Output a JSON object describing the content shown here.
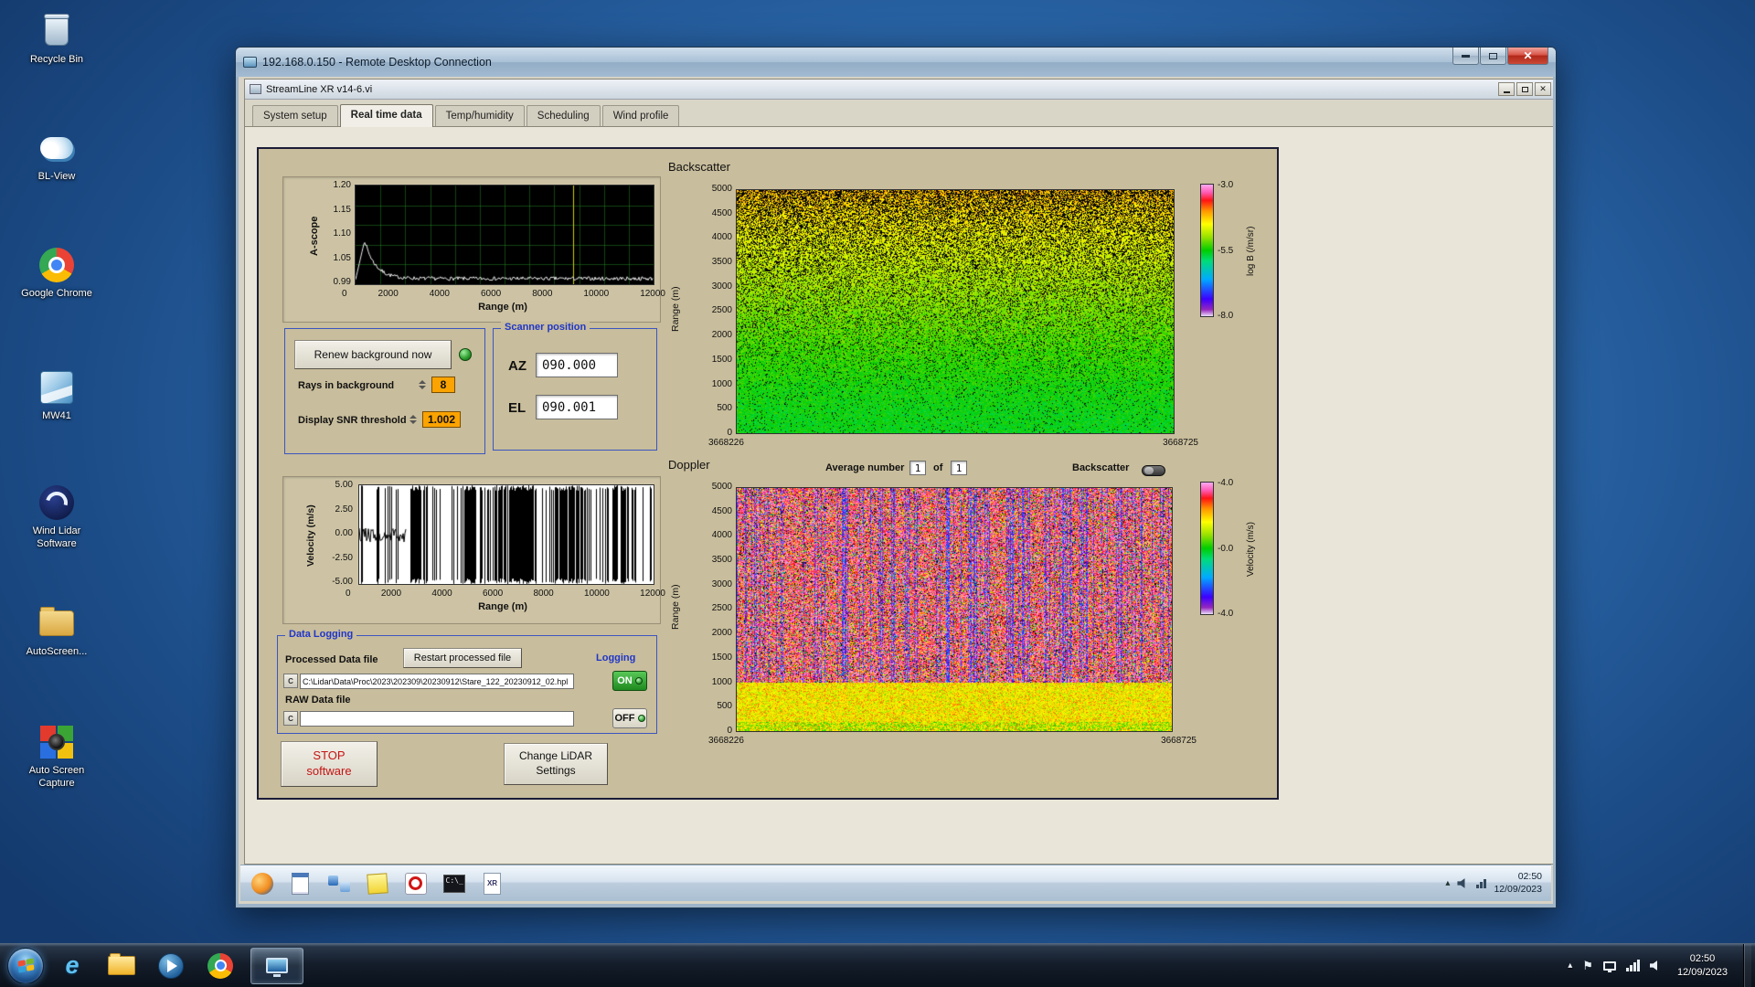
{
  "desktop": {
    "icons": [
      {
        "label": "Recycle Bin"
      },
      {
        "label": "BL-View"
      },
      {
        "label": "Google Chrome"
      },
      {
        "label": "MW41"
      },
      {
        "label": "Wind Lidar Software"
      },
      {
        "label": "AutoScreen..."
      },
      {
        "label": "Auto Screen Capture"
      }
    ]
  },
  "host_taskbar": {
    "pinned_icons": [
      "start",
      "internet-explorer",
      "explorer-folder",
      "media-player",
      "chrome",
      "remote-desktop-active"
    ],
    "tray_icons": [
      "expand-arrow",
      "action-center-flag",
      "display",
      "network",
      "volume"
    ],
    "clock_time": "02:50",
    "clock_date": "12/09/2023"
  },
  "rdp_window": {
    "title": "192.168.0.150 - Remote Desktop Connection",
    "close_glyph": "✕"
  },
  "remote_taskbar": {
    "icons": [
      "browser",
      "notepad",
      "network-places",
      "sticky-notes",
      "power",
      "command-prompt",
      "xr-file"
    ],
    "tray_icons": [
      "expand-arrow",
      "volume",
      "network"
    ],
    "clock_time": "02:50",
    "clock_date": "12/09/2023"
  },
  "app": {
    "title": "StreamLine XR v14-6.vi",
    "close_glyph": "✕",
    "tabs": [
      {
        "label": "System setup"
      },
      {
        "label": "Real time data"
      },
      {
        "label": "Temp/humidity"
      },
      {
        "label": "Scheduling"
      },
      {
        "label": "Wind profile"
      }
    ],
    "active_tab": "Real time data",
    "background": {
      "renew_button": "Renew background now",
      "rays_label": "Rays in background",
      "rays_value": "8",
      "snr_label": "Display SNR threshold",
      "snr_value": "1.002"
    },
    "scanner": {
      "title": "Scanner position",
      "az_label": "AZ",
      "az_value": "090.000",
      "el_label": "EL",
      "el_value": "090.001"
    },
    "logging": {
      "title": "Data Logging",
      "processed_label": "Processed Data file",
      "restart_button": "Restart processed file",
      "processed_path": "C:\\Lidar\\Data\\Proc\\2023\\202309\\20230912\\Stare_122_20230912_02.hpl",
      "raw_label": "RAW Data file",
      "raw_path": "",
      "logging_label": "Logging",
      "on_label": "ON",
      "off_label": "OFF"
    },
    "actions": {
      "stop_button": "STOP software",
      "settings_button": "Change LiDAR Settings"
    },
    "doppler_header": {
      "average_label": "Average number",
      "average_value": "1",
      "of_label": "of",
      "average_total": "1",
      "toggle_label": "Backscatter"
    }
  },
  "chart_data": [
    {
      "name": "a-scope",
      "type": "line",
      "ylabel": "A-scope",
      "xlabel": "Range (m)",
      "yticks": [
        "1.20",
        "1.15",
        "1.10",
        "1.05",
        "0.99"
      ],
      "xticks": [
        "0",
        "2000",
        "4000",
        "6000",
        "8000",
        "10000",
        "12000"
      ],
      "xlim": [
        0,
        12000
      ],
      "ylim": [
        0.99,
        1.2
      ],
      "series_note": "white noisy trace near 1.00 with peak ~1.08 near range 300 m, yellow cursor line near 8800 m, black background with green grid"
    },
    {
      "name": "velocity",
      "type": "line",
      "ylabel": "Velocity (m/s)",
      "xlabel": "Range (m)",
      "yticks": [
        "5.00",
        "2.50",
        "0.00",
        "-2.50",
        "-5.00"
      ],
      "xticks": [
        "0",
        "2000",
        "4000",
        "6000",
        "8000",
        "10000",
        "12000"
      ],
      "xlim": [
        0,
        12000
      ],
      "ylim": [
        -5,
        5
      ],
      "series_note": "trace near 0 below ~1500 m, dense full-scale black vertical excursions beyond, white background"
    },
    {
      "name": "backscatter",
      "type": "heatmap",
      "title": "Backscatter",
      "ylabel": "Range (m)",
      "yticks": [
        "5000",
        "4500",
        "4000",
        "3500",
        "3000",
        "2500",
        "2000",
        "1500",
        "1000",
        "500",
        "0"
      ],
      "x_start": "3668226",
      "x_end": "3668725",
      "colorbar": {
        "label": "log B (/m/sr)",
        "ticks": [
          "-3.0",
          "-5.5",
          "-8.0"
        ]
      },
      "series_note": "uniform green at low range grading to bright yellow-green with black speckle toward 5000 m"
    },
    {
      "name": "doppler",
      "type": "heatmap",
      "title": "Doppler",
      "ylabel": "Range (m)",
      "yticks": [
        "5000",
        "4500",
        "4000",
        "3500",
        "3000",
        "2500",
        "2000",
        "1500",
        "1000",
        "500",
        "0"
      ],
      "x_start": "3668226",
      "x_end": "3668725",
      "colorbar": {
        "label": "Velocity (m/s)",
        "ticks": [
          "-4.0",
          "-0.0",
          "-4.0"
        ]
      },
      "series_note": "magenta-pink noise with dark vertical streaks above ~1000 m, yellow-orange band below ~1000 m"
    }
  ]
}
